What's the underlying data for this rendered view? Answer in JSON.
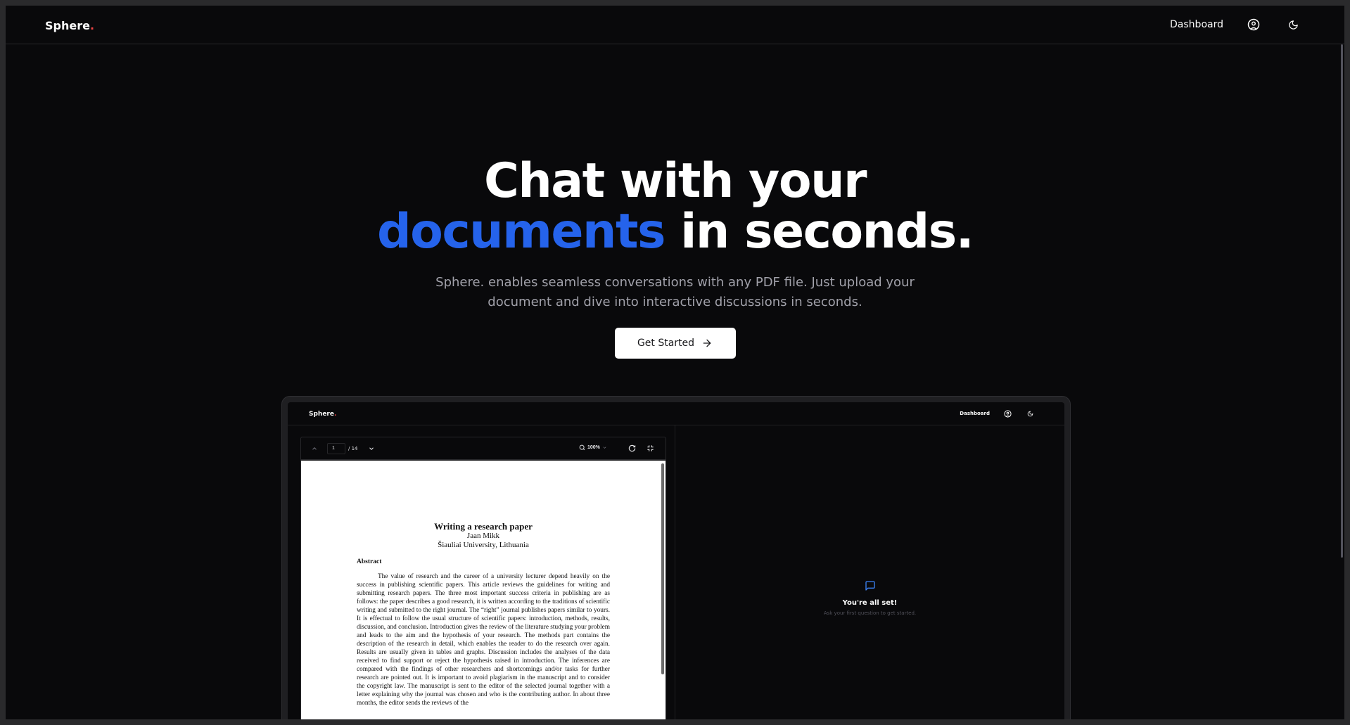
{
  "nav": {
    "brand": "Sphere",
    "brand_dot": ".",
    "dashboard_label": "Dashboard",
    "user_icon": "user-circle-icon",
    "theme_icon": "moon-icon"
  },
  "hero": {
    "title_line1": "Chat with your",
    "title_accent": "documents",
    "title_rest": " in seconds.",
    "subtitle": "Sphere. enables seamless conversations with any PDF file. Just upload your document and dive into interactive discussions in seconds.",
    "cta_label": "Get Started",
    "cta_icon": "arrow-right-icon"
  },
  "preview": {
    "nav": {
      "brand": "Sphere",
      "brand_dot": ".",
      "dashboard_label": "Dashboard"
    },
    "pdf": {
      "page_current": "1",
      "page_total": "/ 14",
      "zoom": "100%",
      "doc_title": "Writing a research paper",
      "doc_author": "Jaan Mikk",
      "doc_affiliation": "Šiauliai University, Lithuania",
      "abstract_heading": "Abstract",
      "abstract_text": "The value of research and the career of a university lecturer depend heavily on the success in publishing scientific papers. This article reviews the guidelines for writing and submitting research papers. The three most important success criteria in publishing are as follows: the paper describes a good research, it is written according to the traditions of scientific writing and submitted to the right journal. The “right” journal publishes papers similar to yours. It is effectual to follow the usual structure of scientific papers: introduction, methods, results, discussion, and conclusion. Introduction gives the review of the literature studying your problem and leads to the aim and the hypothesis of your research. The methods part contains the description of the research in detail, which enables the reader to do the research over again. Results are usually given in tables and graphs. Discussion includes the analyses of the data received to find support or reject the hypothesis raised in introduction. The inferences are compared with the findings of other researchers and shortcomings and/or tasks for further research are pointed out. It is important to avoid plagiarism in the manuscript and to consider the copyright law. The manuscript is sent to the editor of the selected journal together with a letter explaining why the journal was chosen and who is the contributing author. In about three months, the editor sends the reviews of the"
    },
    "chat": {
      "icon": "message-square-icon",
      "title": "You're all set!",
      "hint": "Ask your first question to get started."
    }
  },
  "colors": {
    "background": "#09090b",
    "accent": "#2563eb",
    "brand_dot": "#ef4444",
    "text": "#fafafa",
    "muted": "#a1a1aa"
  }
}
